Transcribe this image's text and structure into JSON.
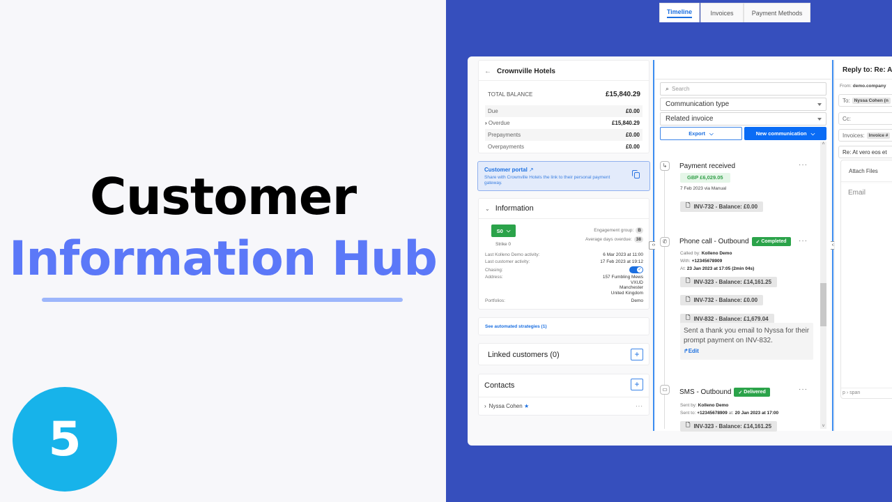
{
  "hero": {
    "title_line1": "Customer",
    "title_line2": "Information Hub",
    "step_number": "5",
    "colors": {
      "accent": "#5b78f8",
      "underline": "#9db6fb",
      "step_circle": "#17b3ea",
      "background_right": "#364fbd"
    }
  },
  "customer": {
    "back_icon": "arrow-left-icon",
    "name": "Crownville Hotels",
    "balance": {
      "total_label": "TOTAL BALANCE",
      "total_value": "£15,840.29",
      "rows": [
        {
          "label": "Due",
          "value": "£0.00",
          "expandable": false
        },
        {
          "label": "Overdue",
          "value": "£15,840.29",
          "expandable": true
        },
        {
          "label": "Prepayments",
          "value": "£0.00",
          "expandable": false
        },
        {
          "label": "Overpayments",
          "value": "£0.00",
          "expandable": false
        }
      ]
    },
    "portal": {
      "title": "Customer portal",
      "description": "Share with Crownville Hotels the link to their personal payment gateway.",
      "external_icon": "external-link-icon",
      "copy_icon": "copy-icon"
    },
    "information": {
      "title": "Information",
      "strike_button": "S0",
      "strike_label": "Strike 0",
      "engagement_label": "Engagement group:",
      "engagement_value": "B",
      "avg_days_label": "Average days overdue:",
      "avg_days_value": "38",
      "details": [
        {
          "label": "Last Kolleno Demo activity:",
          "value": "6 Mar 2023 at 11:00"
        },
        {
          "label": "Last customer activity:",
          "value": "17 Feb 2023 at 19:12"
        }
      ],
      "chasing_label": "Chasing:",
      "chasing_on": true,
      "address_label": "Address:",
      "address_lines": [
        "157 Fumbling Mews",
        "VXUD",
        "Manchester",
        "United Kingdom"
      ],
      "portfolios_label": "Portfolios:",
      "portfolios_value": "Demo"
    },
    "strategies_link": "See automated strategies (1)",
    "linked_customers": "Linked customers (0)",
    "contacts": {
      "title": "Contacts",
      "items": [
        {
          "name": "Nyssa Cohen",
          "primary": true
        }
      ]
    }
  },
  "timeline": {
    "tabs": [
      {
        "label": "Timeline",
        "active": true
      },
      {
        "label": "Invoices",
        "active": false
      },
      {
        "label": "Payment Methods",
        "active": false
      }
    ],
    "search_placeholder": "Search",
    "filters": [
      "Communication type",
      "Related invoice"
    ],
    "export_label": "Export",
    "new_comm_label": "New communication",
    "entries": [
      {
        "type": "payment",
        "icon": "payment-return-icon",
        "title": "Payment received",
        "amount": "GBP £6,029.05",
        "meta": "7 Feb 2023 via Manual",
        "invoices": [
          "INV-732 - Balance: £0.00"
        ]
      },
      {
        "type": "phone",
        "icon": "phone-icon",
        "title": "Phone call - Outbound",
        "status": "Completed",
        "called_by_label": "Called by:",
        "called_by": "Kolleno Demo",
        "with_label": "With:",
        "with": "+12345678909",
        "at_label": "At:",
        "at": "23 Jan 2023 at 17:05 (2min 04s)",
        "invoices": [
          "INV-323 - Balance: £14,161.25",
          "INV-732 - Balance: £0.00",
          "INV-832 - Balance: £1,679.04"
        ],
        "note": "Sent a thank you email to Nyssa for their prompt payment on INV-832.",
        "edit_label": "Edit"
      },
      {
        "type": "sms",
        "icon": "message-icon",
        "title": "SMS - Outbound",
        "status": "Delivered",
        "sent_by_label": "Sent by:",
        "sent_by": "Kolleno Demo",
        "sent_to_label": "Sent to:",
        "sent_to": "+12345678909",
        "at_label": "at:",
        "at": "20 Jan 2023 at 17:00",
        "invoices": [
          "INV-323 - Balance: £14,161.25"
        ]
      }
    ]
  },
  "reply": {
    "title": "Reply to: Re: At",
    "from_label": "From:",
    "from_value": "demo.company",
    "to_label": "To:",
    "to_chip": "Nyssa Cohen (n",
    "cc_label": "Cc:",
    "invoices_label": "Invoices:",
    "invoices_chip": "Invoice #",
    "subject": "Re: At vero eos et",
    "attach_label": "Attach Files",
    "body_placeholder": "Email",
    "path": "p › span"
  }
}
